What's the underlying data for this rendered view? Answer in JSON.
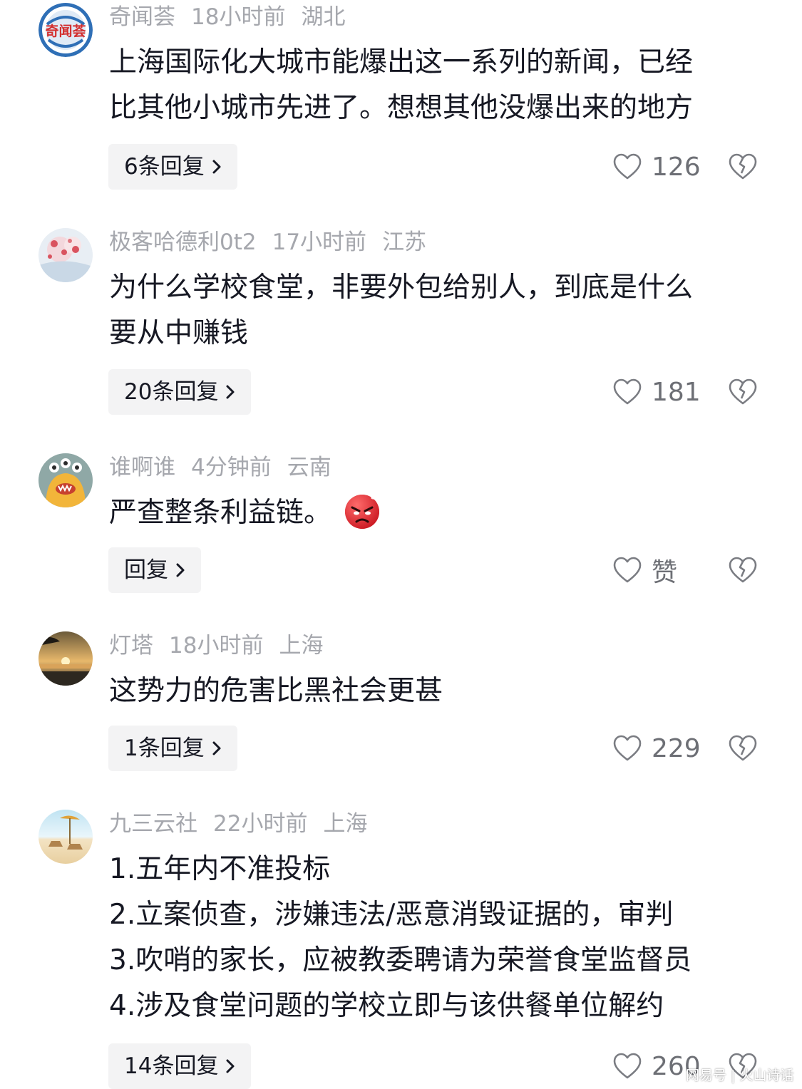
{
  "comments": [
    {
      "username": "奇闻荟",
      "time": "18小时前",
      "location": "湖北",
      "avatar_text": "奇闻荟",
      "lines": [
        "上海国际化大城市能爆出这一系列的新闻，已经",
        "比其他小城市先进了。想想其他没爆出来的地方"
      ],
      "reply_label": "6条回复",
      "likes": "126"
    },
    {
      "username": "极客哈德利0t2",
      "time": "17小时前",
      "location": "江苏",
      "lines": [
        "为什么学校食堂，非要外包给别人，到底是什么",
        "要从中赚钱"
      ],
      "reply_label": "20条回复",
      "likes": "181"
    },
    {
      "username": "谁啊谁",
      "time": "4分钟前",
      "location": "云南",
      "lines": [
        "严查整条利益链。"
      ],
      "emoji": "angry-face-emoji",
      "reply_label": "回复",
      "likes": "赞"
    },
    {
      "username": "灯塔",
      "time": "18小时前",
      "location": "上海",
      "lines": [
        "这势力的危害比黑社会更甚"
      ],
      "reply_label": "1条回复",
      "likes": "229"
    },
    {
      "username": "九三云社",
      "time": "22小时前",
      "location": "上海",
      "lines": [
        "1.五年内不准投标",
        "2.立案侦查，涉嫌违法/恶意消毁证据的，审判",
        "3.吹哨的家长，应被教委聘请为荣誉食堂监督员",
        "4.涉及食堂问题的学校立即与该供餐单位解约"
      ],
      "reply_label": "14条回复",
      "likes": "260"
    }
  ],
  "watermark": "网易号 | 火山诗话",
  "colors": {
    "meta": "#a5a7ad",
    "text": "#161823",
    "reply_bg": "#f3f3f4",
    "like": "#6d6f75"
  }
}
